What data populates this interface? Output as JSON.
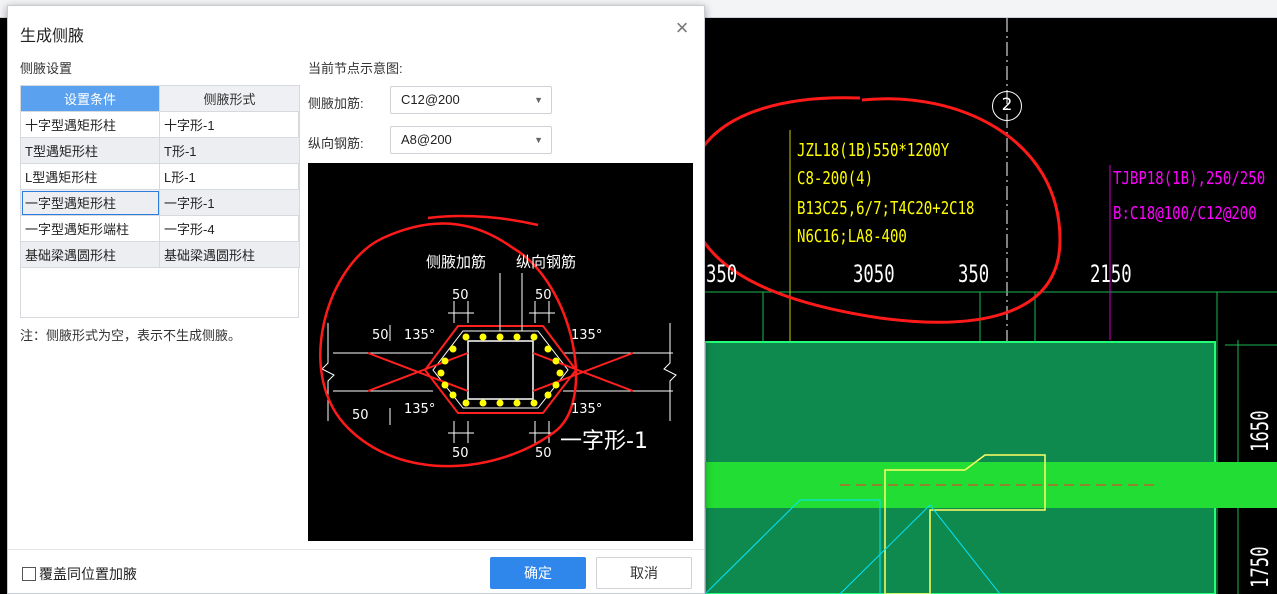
{
  "dialog": {
    "title": "生成侧腋",
    "close_glyph": "×",
    "section_label": "侧腋设置",
    "preview_label": "当前节点示意图:",
    "table": {
      "headers": [
        "设置条件",
        "侧腋形式"
      ],
      "rows": [
        [
          "十字型遇矩形柱",
          "十字形-1"
        ],
        [
          "T型遇矩形柱",
          "T形-1"
        ],
        [
          "L型遇矩形柱",
          "L形-1"
        ],
        [
          "一字型遇矩形柱",
          "一字形-1"
        ],
        [
          "一字型遇矩形端柱",
          "一字形-4"
        ],
        [
          "基础梁遇圆形柱",
          "基础梁遇圆形柱"
        ]
      ]
    },
    "note": "注：侧腋形式为空，表示不生成侧腋。",
    "fields": {
      "side_rebar_label": "侧腋加筋:",
      "side_rebar_value": "C12@200",
      "long_rebar_label": "纵向钢筋:",
      "long_rebar_value": "A8@200"
    },
    "preview": {
      "label_side_rebar": "侧腋加筋",
      "label_long_rebar": "纵向钢筋",
      "dim_50": "50",
      "angle_135": "135°",
      "shape_name": "一字形-1"
    },
    "checkbox_label": "覆盖同位置加腋",
    "ok_label": "确定",
    "cancel_label": "取消"
  },
  "cad": {
    "beam_label_lines": [
      "JZL18(1B)550*1200Y",
      "C8-200(4)",
      "B13C25,6/7;T4C20+2C18",
      "N6C16;LA8-400"
    ],
    "beam2_label_line1": "TJBP18(1B),250/250",
    "beam2_label_line2": "B:C18@100/C12@200",
    "axis_label": "2",
    "dims": {
      "d1": "350",
      "d2": "3050",
      "d3": "350",
      "d4": "2150",
      "v1": "1650",
      "v2": "1750"
    }
  },
  "colors": {
    "primary": "#2f86eb",
    "table_header_active": "#5aa2f0",
    "cad_bg": "#000000",
    "cad_green": "#1db954",
    "cad_yellow": "#ffff00",
    "cad_magenta": "#ff00ff",
    "annotation_red": "#ff1a1a"
  }
}
